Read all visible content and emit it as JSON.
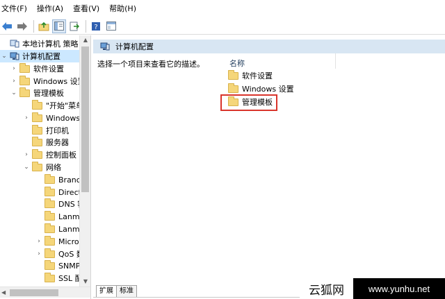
{
  "menubar": {
    "items": [
      "文件(F)",
      "操作(A)",
      "查看(V)",
      "帮助(H)"
    ]
  },
  "toolbar": {
    "buttons": [
      "back-icon",
      "forward-icon",
      "up-folder-icon",
      "show-hide-tree-icon",
      "export-list-icon",
      "help-icon",
      "properties-view-icon"
    ]
  },
  "tree": {
    "items": [
      {
        "label": "本地计算机 策略",
        "expander": "",
        "icon": "computer-policy-icon"
      },
      {
        "label": "计算机配置",
        "expander": "v",
        "icon": "computer-icon"
      },
      {
        "label": "软件设置",
        "expander": ">",
        "icon": "folder-icon"
      },
      {
        "label": "Windows 设置",
        "expander": ">",
        "icon": "folder-icon"
      },
      {
        "label": "管理模板",
        "expander": "v",
        "icon": "folder-icon"
      },
      {
        "label": "\"开始\"菜单",
        "expander": "",
        "icon": "folder-icon"
      },
      {
        "label": "Windows",
        "expander": ">",
        "icon": "folder-icon"
      },
      {
        "label": "打印机",
        "expander": "",
        "icon": "folder-icon"
      },
      {
        "label": "服务器",
        "expander": "",
        "icon": "folder-icon"
      },
      {
        "label": "控制面板",
        "expander": ">",
        "icon": "folder-icon"
      },
      {
        "label": "网络",
        "expander": "v",
        "icon": "folder-icon"
      },
      {
        "label": "Branch",
        "expander": "",
        "icon": "folder-icon"
      },
      {
        "label": "Direct",
        "expander": "",
        "icon": "folder-icon"
      },
      {
        "label": "DNS 客",
        "expander": "",
        "icon": "folder-icon"
      },
      {
        "label": "Lanma",
        "expander": "",
        "icon": "folder-icon"
      },
      {
        "label": "Lanma",
        "expander": "",
        "icon": "folder-icon"
      },
      {
        "label": "Micro",
        "expander": ">",
        "icon": "folder-icon"
      },
      {
        "label": "QoS 数",
        "expander": ">",
        "icon": "folder-icon"
      },
      {
        "label": "SNMP",
        "expander": "",
        "icon": "folder-icon"
      },
      {
        "label": "SSL 配",
        "expander": "",
        "icon": "folder-icon"
      }
    ]
  },
  "right_pane": {
    "header_title": "计算机配置",
    "description": "选择一个项目来查看它的描述。",
    "column_header": "名称",
    "items": [
      "软件设置",
      "Windows 设置",
      "管理模板"
    ],
    "tabs": [
      "扩展",
      "标准"
    ]
  },
  "watermark": {
    "left_text": "云狐网",
    "right_text": "www.yunhu.net"
  },
  "colors": {
    "selection": "#cce8ff",
    "pane_header": "#d8e6f3",
    "highlight_box": "#d9342b",
    "folder": "#f5d67a"
  }
}
